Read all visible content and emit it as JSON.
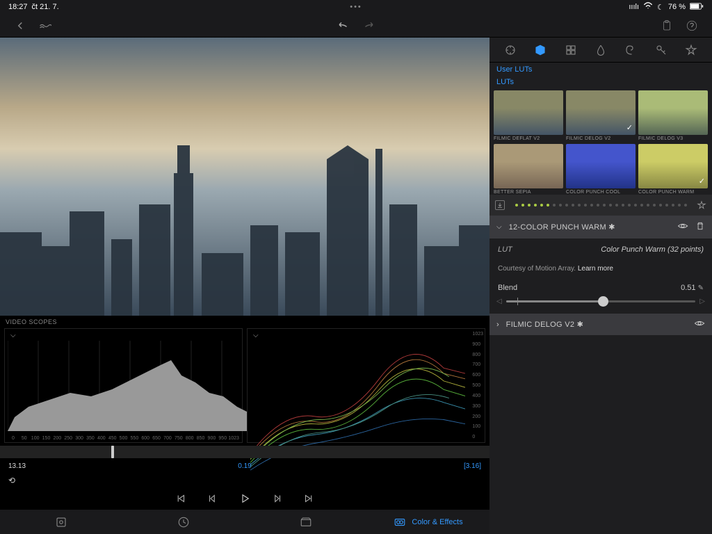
{
  "status": {
    "time": "18:27",
    "date": "čt 21. 7.",
    "battery": "76 %"
  },
  "tabs_right": [
    "adjust",
    "cube",
    "grid",
    "drop",
    "spiral",
    "key",
    "star"
  ],
  "sections": {
    "user_luts": "User LUTs",
    "luts": "LUTs"
  },
  "luts": [
    {
      "name": "FILMIC DEFLAT V2",
      "cls": "",
      "selected": false
    },
    {
      "name": "FILMIC DELOG V2",
      "cls": "",
      "selected": true
    },
    {
      "name": "FILMIC DELOG V3",
      "cls": "v3",
      "selected": false
    },
    {
      "name": "BETTER SEPIA",
      "cls": "sepia",
      "selected": false
    },
    {
      "name": "COLOR PUNCH COOL",
      "cls": "cool",
      "selected": false
    },
    {
      "name": "COLOR PUNCH WARM",
      "cls": "warm",
      "selected": true
    }
  ],
  "expanded": {
    "title": "12-COLOR PUNCH WARM ✱",
    "lut_label": "LUT",
    "lut_value": "Color Punch Warm (32 points)",
    "courtesy": "Courtesy of Motion Array. ",
    "learn": "Learn more",
    "blend_label": "Blend",
    "blend_value": "0.51",
    "blend_pct": 51
  },
  "collapsed": {
    "title": "FILMIC DELOG V2 ✱"
  },
  "scopes_label": "VIDEO SCOPES",
  "histogram_x": [
    "0",
    "50",
    "100",
    "150",
    "200",
    "250",
    "300",
    "350",
    "400",
    "450",
    "500",
    "550",
    "600",
    "650",
    "700",
    "750",
    "800",
    "850",
    "900",
    "950",
    "1023"
  ],
  "waveform_y": [
    "1023",
    "900",
    "800",
    "700",
    "600",
    "500",
    "400",
    "300",
    "200",
    "100",
    "0"
  ],
  "time": {
    "current": "13.13",
    "offset": "0.19",
    "duration": "[3.16]"
  },
  "bottom_tabs": {
    "library": "",
    "history": "",
    "clips": "",
    "effects": "Color & Effects"
  }
}
